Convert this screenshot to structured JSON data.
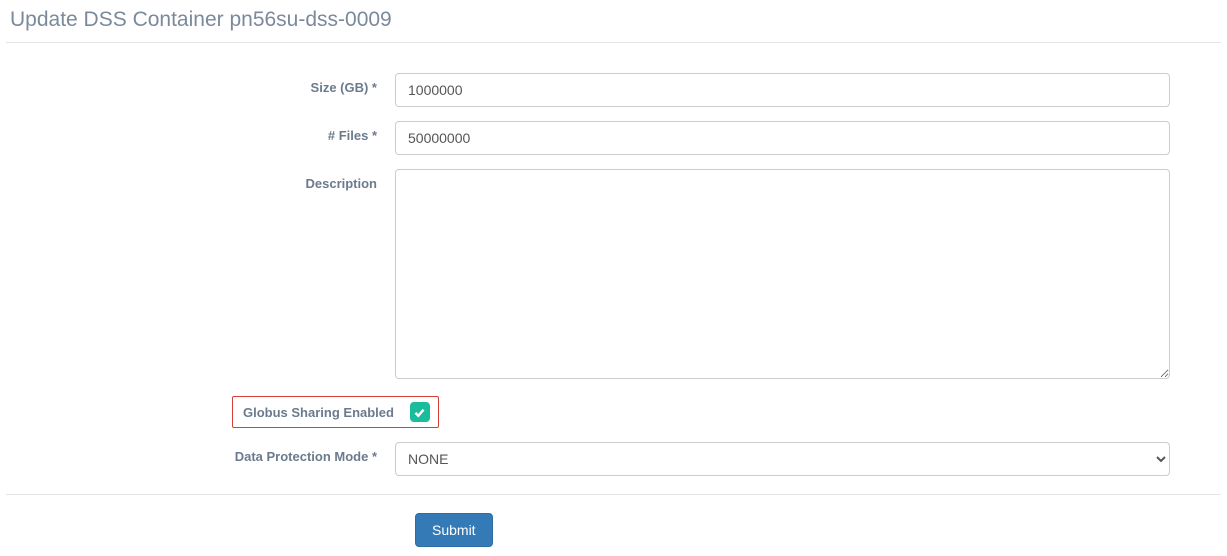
{
  "page": {
    "title": "Update DSS Container pn56su-dss-0009"
  },
  "form": {
    "size": {
      "label": "Size (GB) *",
      "value": "1000000"
    },
    "files": {
      "label": "# Files *",
      "value": "50000000"
    },
    "description": {
      "label": "Description",
      "value": ""
    },
    "globus": {
      "label": "Globus Sharing Enabled",
      "checked": true
    },
    "protection": {
      "label": "Data Protection Mode *",
      "value": "NONE",
      "options": [
        "NONE"
      ]
    },
    "submit": {
      "label": "Submit"
    }
  }
}
